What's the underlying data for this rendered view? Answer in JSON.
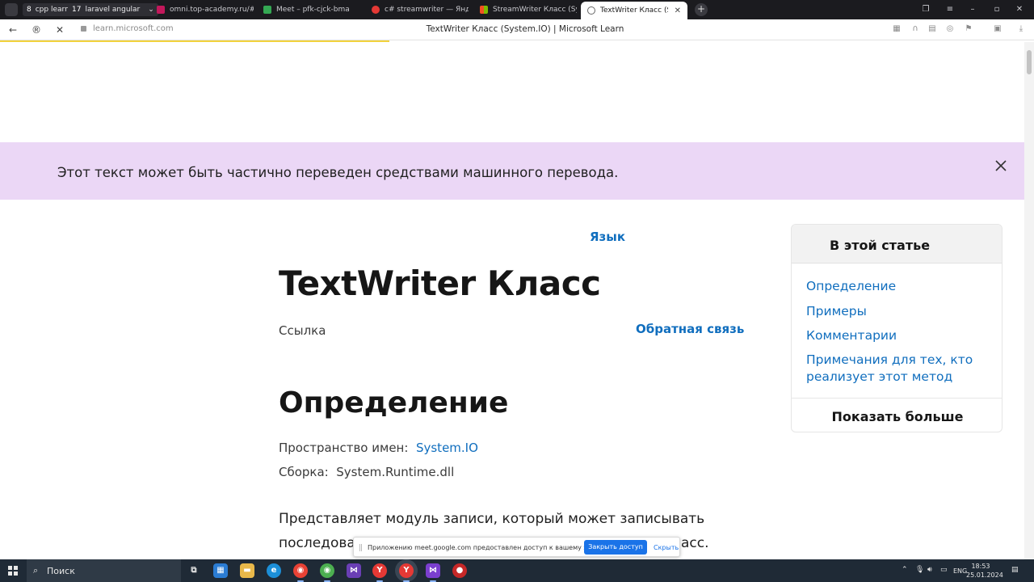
{
  "browser": {
    "tab_groups": [
      {
        "count": "8",
        "label": "cpp learn"
      },
      {
        "count": "17",
        "label": "laravel angular"
      }
    ],
    "tabs": [
      {
        "title": "omni.top-academy.ru/#/p",
        "favicon_color": "#c2185b"
      },
      {
        "title": "Meet – pfk-cjck-bma",
        "favicon_color": "#34a853"
      },
      {
        "title": "c# streamwriter — Яндекс",
        "favicon_color": "#e53935"
      },
      {
        "title": "StreamWriter Класс (Syste",
        "favicon_color": "#f25022"
      },
      {
        "title": "TextWriter Класс (Syste",
        "favicon_color": "#666666",
        "active": true
      }
    ],
    "url": "learn.microsoft.com",
    "page_title": "TextWriter Класс (System.IO) | Microsoft Learn"
  },
  "page": {
    "banner_text": "Этот текст может быть частично переведен средствами машинного перевода.",
    "language_link": "Язык",
    "title": "TextWriter Класс",
    "reference": "Ссылка",
    "feedback": "Обратная связь",
    "definition_heading": "Определение",
    "namespace_label": "Пространство имен:",
    "namespace_value": "System.IO",
    "assembly_label": "Сборка:",
    "assembly_value": "System.Runtime.dll",
    "description_line1": "Представляет модуль записи, который может записывать",
    "description_line2_start": "последова",
    "description_line2_end": "асс."
  },
  "toc": {
    "heading": "В этой статье",
    "items": [
      "Определение",
      "Примеры",
      "Комментарии",
      "Примечания для тех, кто",
      "реализует этот метод"
    ],
    "show_more": "Показать больше"
  },
  "screen_share": {
    "message": "Приложению meet.google.com предоставлен доступ к вашему экрану.",
    "stop_button": "Закрыть доступ",
    "hide_link": "Скрыть"
  },
  "taskbar": {
    "search_label": "Поиск",
    "lang": "ENG",
    "time": "18:53",
    "date": "25.01.2024"
  }
}
